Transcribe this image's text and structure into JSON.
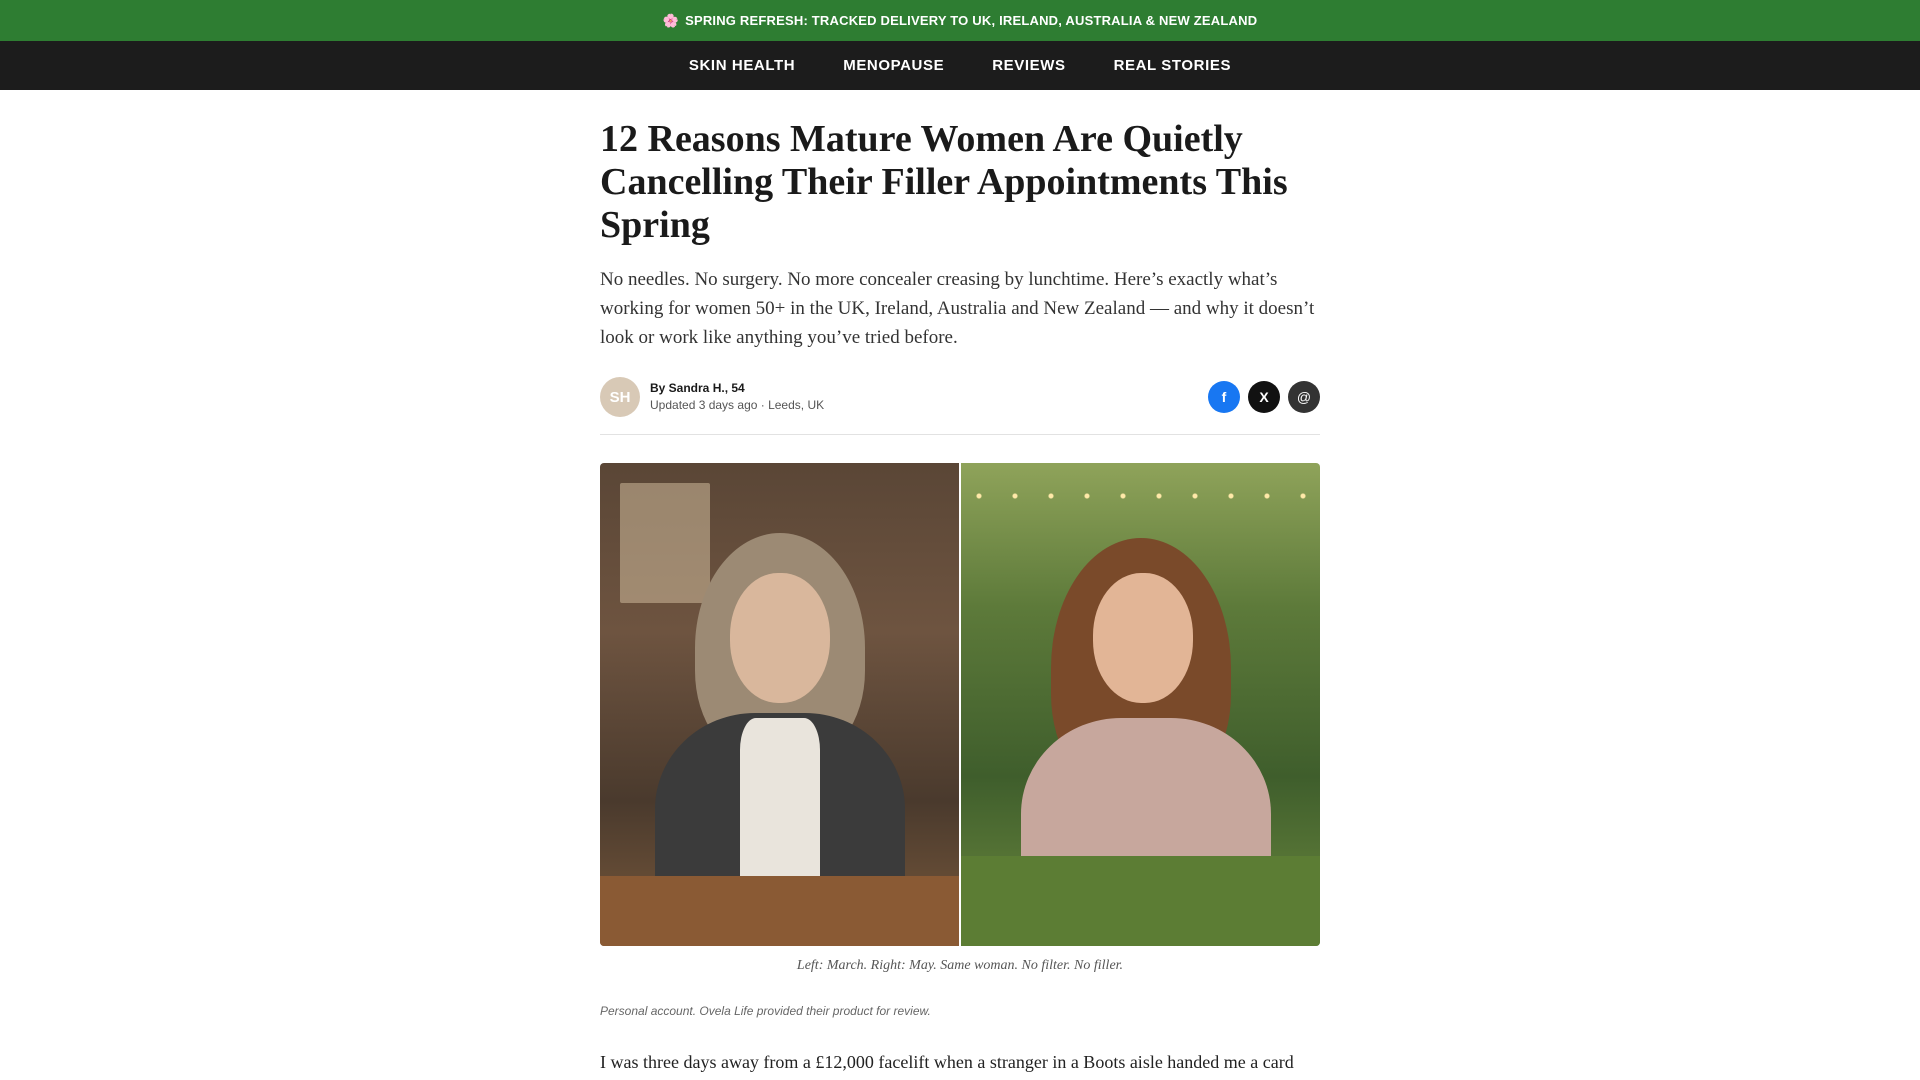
{
  "promo": {
    "icon": "flower-icon",
    "text": "SPRING REFRESH: TRACKED DELIVERY TO UK, IRELAND, AUSTRALIA & NEW ZEALAND",
    "background": "#2e7d32"
  },
  "nav": {
    "items": [
      {
        "label": "SKIN HEALTH"
      },
      {
        "label": "MENOPAUSE"
      },
      {
        "label": "REVIEWS"
      },
      {
        "label": "REAL STORIES"
      }
    ]
  },
  "article": {
    "headline": "12 Reasons Mature Women Are Quietly Cancelling Their Filler Appointments This Spring",
    "dek": "No needles. No surgery. No more concealer creasing by lunchtime. Here’s exactly what’s working for women 50+ in the UK, Ireland, Australia and New Zealand — and why it doesn’t look or work like anything you’ve tried before.",
    "author": {
      "initials": "SH",
      "name": "By Sandra H., 54",
      "meta": "Updated 3 days ago · Leeds, UK"
    },
    "share": {
      "facebook": "f",
      "x": "X",
      "email": "@"
    },
    "caption": "Left: March. Right: May. Same woman. No filter. No filler.",
    "disclosure": "Personal account. Ovela Life provided their product for review.",
    "body_first_line": "I was three days away from a £12,000 facelift when a stranger in a Boots aisle handed me a card"
  }
}
